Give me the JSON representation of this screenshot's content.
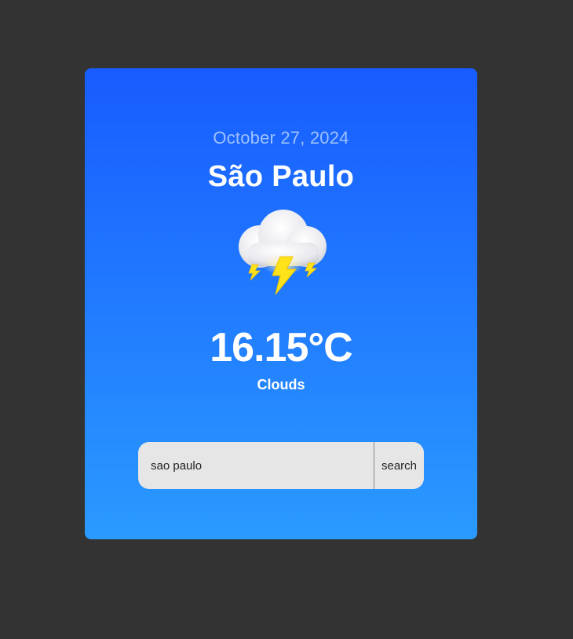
{
  "weather": {
    "date": "October 27, 2024",
    "city": "São Paulo",
    "temperature": "16.15°C",
    "condition": "Clouds",
    "icon": "thunderstorm-cloud-icon"
  },
  "search": {
    "value": "sao paulo",
    "button_label": "search"
  },
  "colors": {
    "background": "#333333",
    "card_gradient_top": "#185cff",
    "card_gradient_bottom": "#2a9aff",
    "date_text": "#9cc1ff",
    "lightning": "#ffe31a"
  }
}
